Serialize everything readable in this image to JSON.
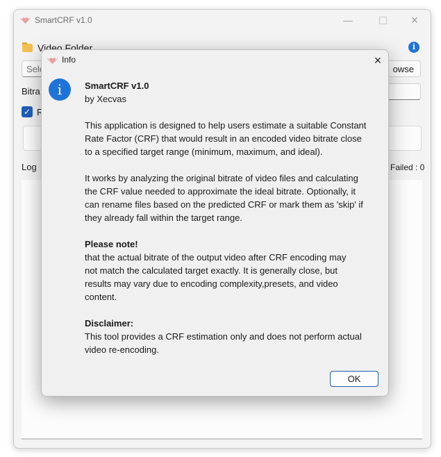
{
  "main_window": {
    "title": "SmartCRF v1.0",
    "folder_label": "Video Folder",
    "select_placeholder": "Sele",
    "browse_label": "owse",
    "bitrate_label": "Bitra",
    "rename_checkbox_label": "R",
    "log_label": "Log",
    "failed_label": "Failed : 0"
  },
  "dialog": {
    "title": "Info",
    "app_name": "SmartCRF v1.0",
    "author": "by Xecvas",
    "description_lines": [
      "This application is designed to help users estimate a suitable Constant",
      "Rate Factor (CRF) that would result in an encoded video bitrate close",
      "to a specified target range (minimum, maximum, and ideal)."
    ],
    "analysis_lines": [
      "It works by analyzing the original bitrate of video files and calculating",
      "the CRF value needed to approximate the ideal bitrate. Optionally, it",
      "can rename files based on the predicted CRF or mark them as 'skip' if",
      "they already fall within the target range."
    ],
    "note_heading": "Please note!",
    "note_lines": [
      "that the actual bitrate of the output video after CRF encoding may",
      "not match the calculated target exactly. It is generally close, but",
      "results may vary due to encoding complexity,presets, and video",
      "content."
    ],
    "disclaimer_heading": "Disclaimer:",
    "disclaimer_lines": [
      "This tool provides a CRF estimation only and does not perform actual",
      "video re-encoding."
    ],
    "ok_label": "OK"
  },
  "icons": {
    "app": "heart-wings-icon",
    "folder": "folder-icon",
    "info": "info-icon",
    "close": "close-icon"
  },
  "colors": {
    "accent": "#1f73d8",
    "folder": "#f2c14e"
  }
}
